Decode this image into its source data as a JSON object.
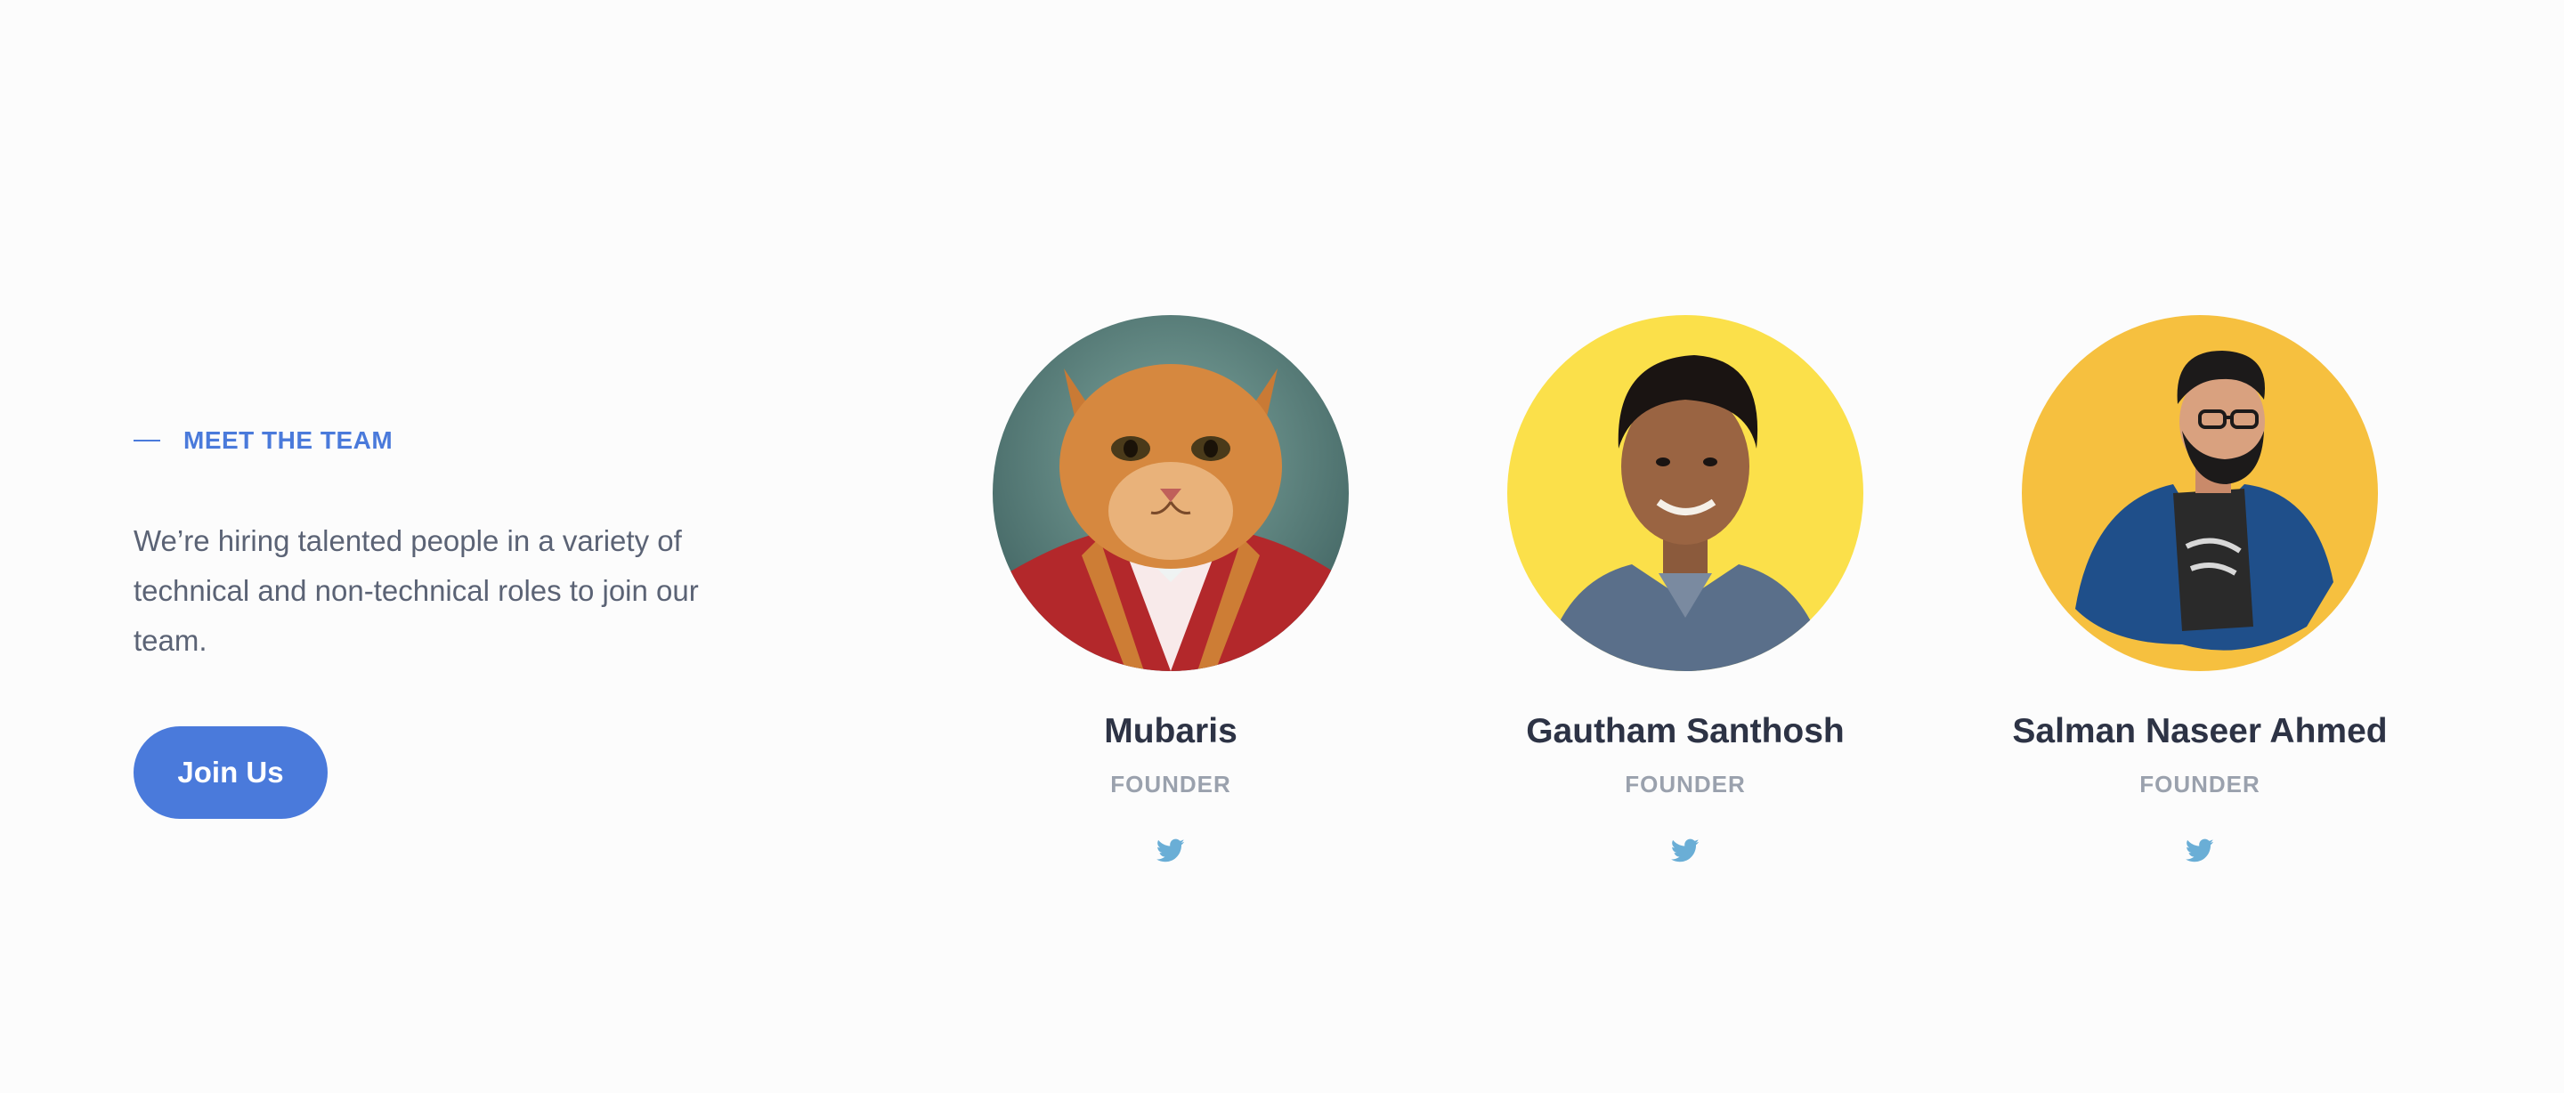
{
  "intro": {
    "eyebrow": "MEET THE TEAM",
    "description": "We’re hiring talented people in a variety of technical and non-technical roles to join our team.",
    "cta_label": "Join Us"
  },
  "team": [
    {
      "name": "Mubaris",
      "role": "FOUNDER",
      "social": "twitter-icon"
    },
    {
      "name": "Gautham Santhosh",
      "role": "FOUNDER",
      "social": "twitter-icon"
    },
    {
      "name": "Salman Naseer Ahmed",
      "role": "FOUNDER",
      "social": "twitter-icon"
    }
  ],
  "colors": {
    "accent": "#4a7adb",
    "heading": "#2d3345",
    "body": "#5b6375",
    "muted": "#9aa1ad",
    "twitter": "#6aaed6",
    "avatar_bg_2": "#fbe04a",
    "avatar_bg_3": "#f6c03f"
  }
}
